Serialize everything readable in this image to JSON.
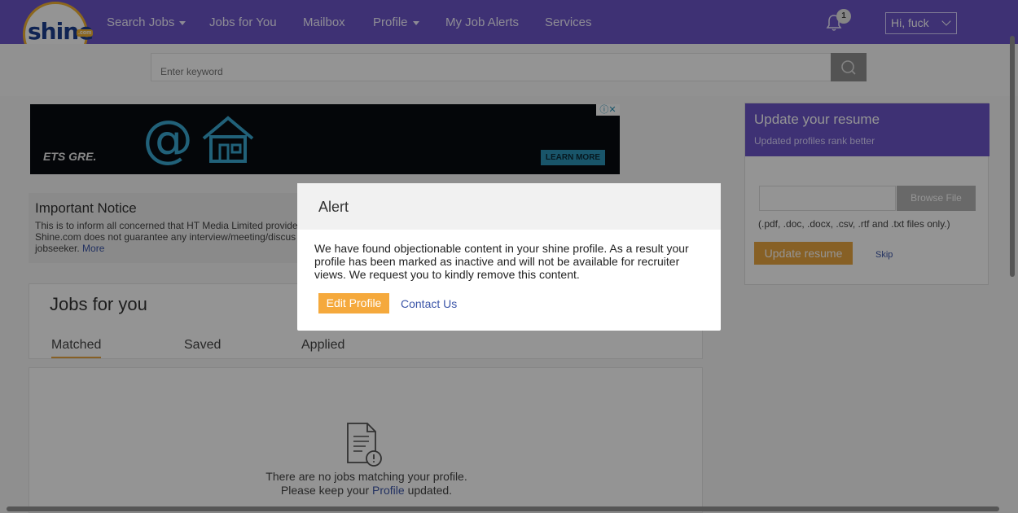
{
  "nav": {
    "logo_text": "shine",
    "logo_suffix": ".com",
    "items": [
      {
        "label": "Search Jobs",
        "dropdown": true
      },
      {
        "label": "Jobs for You",
        "dropdown": false
      },
      {
        "label": "Mailbox",
        "dropdown": false
      },
      {
        "label": "Profile",
        "dropdown": true
      },
      {
        "label": "My Job Alerts",
        "dropdown": false
      },
      {
        "label": "Services",
        "dropdown": false
      }
    ],
    "notification_count": "1",
    "user_greeting": "Hi,  fuck",
    "bell_icon": "bell-icon",
    "chevron_icon": "chevron-down-icon"
  },
  "search": {
    "placeholder": "Enter keyword",
    "button_icon": "search-icon"
  },
  "ad": {
    "brand": "ETS GRE.",
    "cta": "LEARN MORE",
    "close_glyphs": "ⓘ✕"
  },
  "notice": {
    "title": "Important Notice",
    "line1": "This is to inform all concerned that HT Media Limited provide",
    "line2": "Shine.com does not guarantee any interview/meeting/discus",
    "line3": "jobseeker.",
    "more": "More"
  },
  "jobs": {
    "title": "Jobs for you",
    "tabs": [
      {
        "label": "Matched",
        "active": true
      },
      {
        "label": "Saved",
        "active": false
      },
      {
        "label": "Applied",
        "active": false
      }
    ],
    "empty_line1": "There are no jobs matching your profile.",
    "empty_line2_prefix": "Please keep your",
    "empty_link": "Profile",
    "empty_line2_suffix": "updated.",
    "empty_icon": "document-alert-icon"
  },
  "resume": {
    "title": "Update your resume",
    "subtitle": "Updated profiles rank better",
    "browse": "Browse File",
    "note": "(.pdf, .doc, .docx, .csv, .rtf and .txt files only.)",
    "update_btn": "Update resume",
    "skip": "Skip"
  },
  "modal": {
    "title": "Alert",
    "body": "We have found objectionable content in your shine profile. As a result your profile has been marked as inactive and will not be available for recruiter views. We request you to kindly remove this content.",
    "edit_btn": "Edit Profile",
    "contact_link": "Contact Us"
  },
  "colors": {
    "brand_purple": "#6b55c9",
    "accent_orange": "#f5a93c",
    "link_blue": "#3b55a8"
  }
}
